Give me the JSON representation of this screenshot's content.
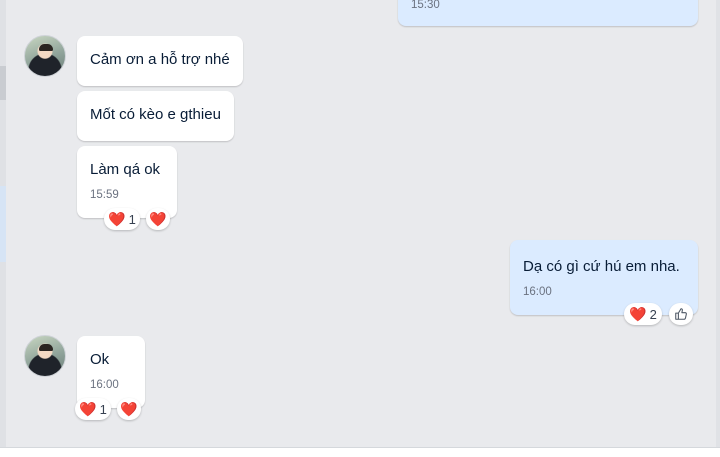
{
  "chat": {
    "top_partial": {
      "time": "15:30"
    },
    "group1": {
      "messages": [
        {
          "text": "Cảm ơn a hỗ trợ nhé"
        },
        {
          "text": "Mốt có kèo e gthieu"
        },
        {
          "text": "Làm qá ok",
          "time": "15:59"
        }
      ],
      "reaction": {
        "emoji": "❤️",
        "count": "1"
      },
      "react_button": "❤️"
    },
    "reply": {
      "text": "Dạ có gì cứ hú em nha.",
      "time": "16:00",
      "reaction": {
        "emoji": "❤️",
        "count": "2"
      },
      "like_icon": "thumbs-up-icon"
    },
    "group2": {
      "messages": [
        {
          "text": "Ok",
          "time": "16:00"
        }
      ],
      "reaction": {
        "emoji": "❤️",
        "count": "1"
      },
      "react_button": "❤️"
    }
  },
  "colors": {
    "background": "#e9eaed",
    "incoming_bubble": "#ffffff",
    "outgoing_bubble": "#dbebff",
    "heart": "#e0245e"
  }
}
